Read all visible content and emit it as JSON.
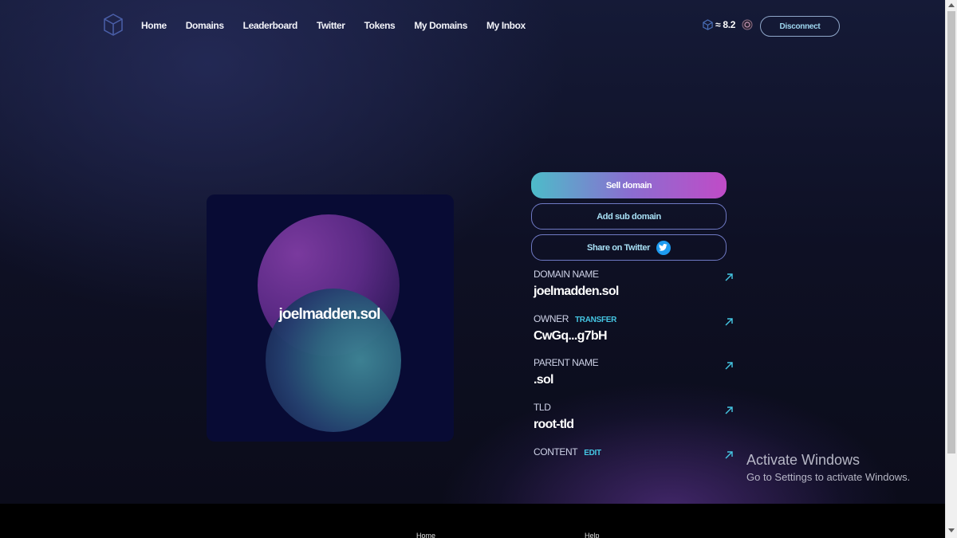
{
  "nav": {
    "links": [
      {
        "label": "Home"
      },
      {
        "label": "Domains"
      },
      {
        "label": "Leaderboard"
      },
      {
        "label": "Twitter"
      },
      {
        "label": "Tokens"
      },
      {
        "label": "My Domains"
      },
      {
        "label": "My Inbox"
      }
    ],
    "balance": "≈ 8.2",
    "disconnect_label": "Disconnect"
  },
  "domain_card": {
    "name": "joelmadden.sol"
  },
  "actions": {
    "sell_label": "Sell domain",
    "add_sub_label": "Add sub domain",
    "share_label": "Share on Twitter"
  },
  "details": {
    "domain_name": {
      "label": "DOMAIN NAME",
      "value": "joelmadden.sol"
    },
    "owner": {
      "label": "OWNER",
      "action": "TRANSFER",
      "value": "CwGq...g7bH"
    },
    "parent_name": {
      "label": "PARENT NAME",
      "value": ".sol"
    },
    "tld": {
      "label": "TLD",
      "value": "root-tld"
    },
    "content": {
      "label": "CONTENT",
      "action": "EDIT",
      "value": ""
    }
  },
  "watermark": {
    "title": "Activate Windows",
    "subtitle": "Go to Settings to activate Windows."
  },
  "footer": {
    "links": [
      {
        "label": "Home"
      },
      {
        "label": "Help"
      }
    ]
  },
  "colors": {
    "accent_cyan": "#45c7e4",
    "sell_gradient_start": "#4dbcc9",
    "sell_gradient_end": "#c04bc7",
    "twitter_blue": "#1d9bf0",
    "card_bg": "#080b34"
  }
}
